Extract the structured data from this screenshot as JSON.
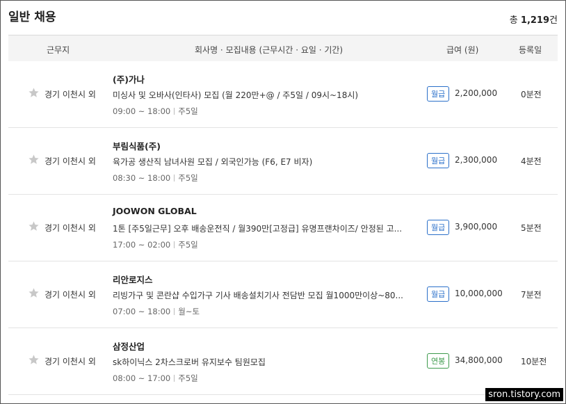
{
  "header": {
    "title": "일반 채용",
    "total_prefix": "총",
    "total_count": "1,219",
    "total_suffix": "건"
  },
  "columns": {
    "location": "근무지",
    "job": "회사명 · 모집내용 (근무시간 · 요일 · 기간)",
    "pay": "급여 (원)",
    "date": "등록일"
  },
  "jobs": [
    {
      "location": "경기 이천시 외",
      "company": "(주)가나",
      "title": "미싱사 및 오바사(인타사) 모집 (월 220만+@ / 주5일 / 09시~18시)",
      "hours": "09:00 ~ 18:00",
      "days": "주5일",
      "pay_type": "월급",
      "pay": "2,200,000",
      "posted": "0분전"
    },
    {
      "location": "경기 이천시 외",
      "company": "부림식품(주)",
      "title": "육가공 생산직 남녀사원 모집 / 외국인가능 (F6, E7 비자)",
      "hours": "08:30 ~ 18:00",
      "days": "주5일",
      "pay_type": "월급",
      "pay": "2,300,000",
      "posted": "4분전"
    },
    {
      "location": "경기 이천시 외",
      "company": "JOOWON GLOBAL",
      "title": "1톤 [주5일근무] 오후 배송운전직 / 월390만[고정급] 유명프랜차이즈/ 안정된 고...",
      "hours": "17:00 ~ 02:00",
      "days": "주5일",
      "pay_type": "월급",
      "pay": "3,900,000",
      "posted": "5분전"
    },
    {
      "location": "경기 이천시 외",
      "company": "리안로지스",
      "title": "리빙가구 및 콘란샵 수입가구 기사 배송설치기사 전담반 모집 월1000만이상~80...",
      "hours": "07:00 ~ 18:00",
      "days": "월~토",
      "pay_type": "월급",
      "pay": "10,000,000",
      "posted": "7분전"
    },
    {
      "location": "경기 이천시 외",
      "company": "삼정산업",
      "title": "sk하이닉스 2차스크로버 유지보수 팀원모집",
      "hours": "08:00 ~ 17:00",
      "days": "주5일",
      "pay_type": "연봉",
      "pay": "34,800,000",
      "posted": "10분전"
    }
  ],
  "watermark": "sron.tistory.com",
  "colors": {
    "monthly_badge": "#2a6fc9",
    "yearly_badge": "#3d9a4b",
    "star": "#c8c8c8"
  }
}
